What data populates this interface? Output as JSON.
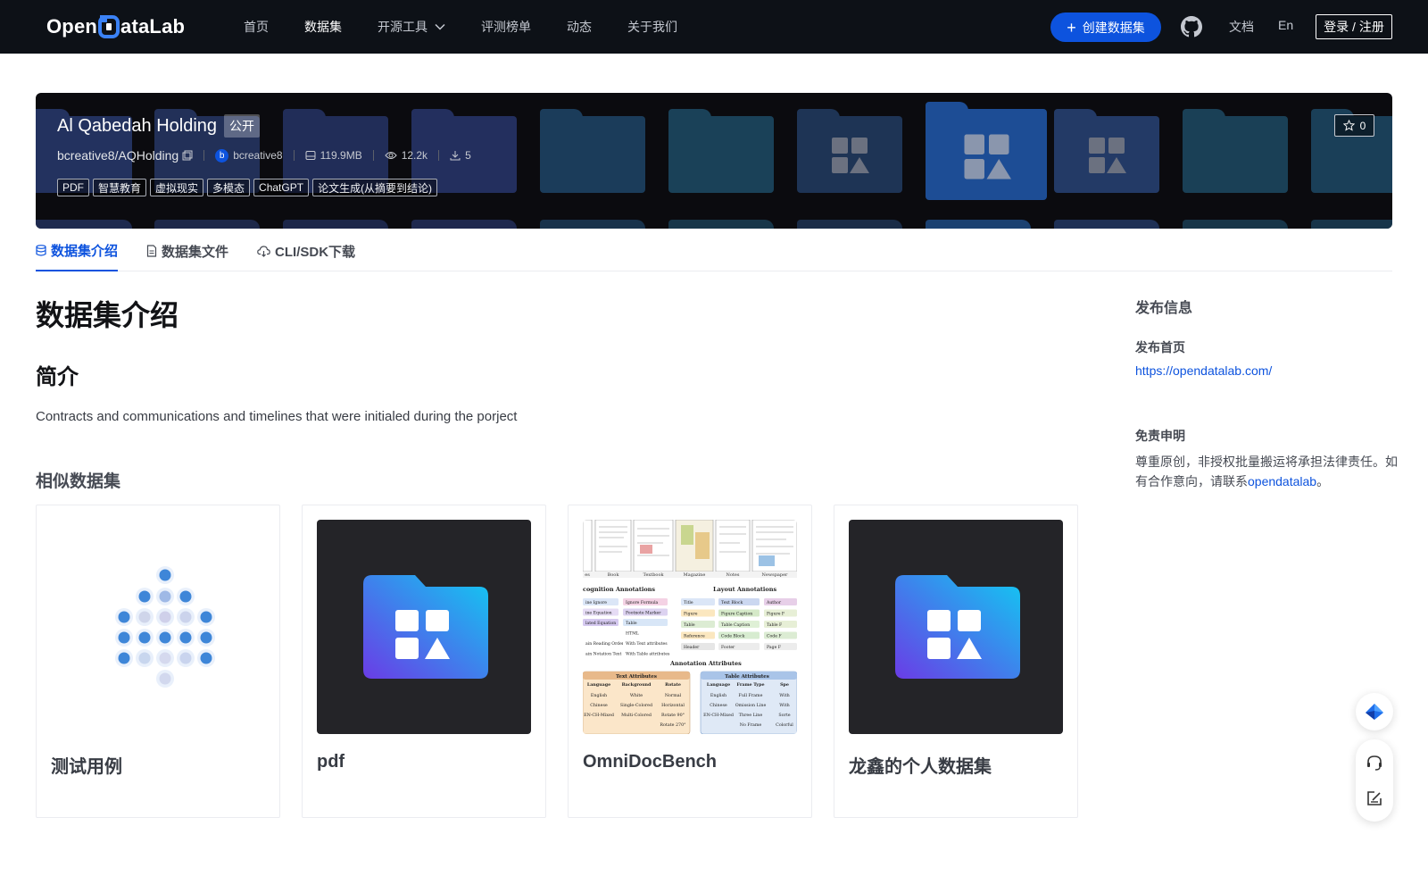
{
  "nav": {
    "logo": {
      "left": "Open",
      "right": "ataLab"
    },
    "menu": [
      {
        "label": "首页",
        "active": false
      },
      {
        "label": "数据集",
        "active": true
      },
      {
        "label": "开源工具",
        "active": false,
        "dropdown": true
      },
      {
        "label": "评测榜单",
        "active": false
      },
      {
        "label": "动态",
        "active": false
      },
      {
        "label": "关于我们",
        "active": false
      }
    ],
    "create_label": "创建数据集",
    "github_icon": "github-icon",
    "docs_label": "文档",
    "lang_label": "En",
    "login_label": "登录 / 注册"
  },
  "banner": {
    "title": "Al Qabedah Holding",
    "visibility": "公开",
    "repo": "bcreative8/AQHolding",
    "author_initial": "b",
    "author": "bcreative8",
    "size": "119.9MB",
    "views": "12.2k",
    "downloads": "5",
    "tags": [
      "PDF",
      "智慧教育",
      "虚拟现实",
      "多模态",
      "ChatGPT",
      "论文生成(从摘要到结论)"
    ],
    "stars": "0"
  },
  "tabs": [
    {
      "label": "数据集介绍",
      "icon": "database-icon",
      "active": true
    },
    {
      "label": "数据集文件",
      "icon": "file-icon",
      "active": false
    },
    {
      "label": "CLI/SDK下载",
      "icon": "cloud-download-icon",
      "active": false
    }
  ],
  "main": {
    "title": "数据集介绍",
    "intro_heading": "简介",
    "description": "Contracts and communications and timelines that were initialed during the porject",
    "similar_heading": "相似数据集",
    "similar": [
      {
        "name": "测试用例",
        "thumb": "dots"
      },
      {
        "name": "pdf",
        "thumb": "folder"
      },
      {
        "name": "OmniDocBench",
        "thumb": "document-collage"
      },
      {
        "name": "龙鑫的个人数据集",
        "thumb": "folder"
      }
    ],
    "omni_thumb": {
      "top_labels": [
        "es",
        "Book",
        "Textbook",
        "Magazine",
        "Notes",
        "Newspaper"
      ],
      "recog_heading": "cognition Annotations",
      "layout_heading": "Layout Annotations",
      "attr_heading": "Annotation Attributes",
      "text_attr_heading": "Text Attributes",
      "table_attr_heading": "Table Attributes",
      "recog_col1": [
        "ine Ignore",
        "ine Equation",
        "lated Equation",
        "",
        "ain Reading Order",
        "ain Notation Text"
      ],
      "recog_col2": [
        "Ignore Formula",
        "Footnote Marker",
        "Table",
        "HTML",
        "With Text attributes",
        "With Table attributes"
      ],
      "layout_col1": [
        "Title",
        "Figure",
        "Table",
        "Reference",
        "Header"
      ],
      "layout_col2": [
        "Text Block",
        "Figure Caption",
        "Table Caption",
        "Code Block",
        "Footer"
      ],
      "layout_col3": [
        "Author",
        "Figure F",
        "Table F",
        "Code F",
        "Page F"
      ],
      "text_attr_cols": [
        "Language",
        "Background",
        "Rotate"
      ],
      "text_attr_rows": [
        [
          "English",
          "White",
          "Normal"
        ],
        [
          "Chinese",
          "Single-Colored",
          "Horizontal"
        ],
        [
          "EN-CH-Mixed",
          "Multi-Colored",
          "Rotate 90°"
        ],
        [
          "",
          "",
          "Rotate 270°"
        ]
      ],
      "table_attr_cols": [
        "Language",
        "Frame Type",
        "Spe"
      ],
      "table_attr_rows": [
        [
          "English",
          "Full Frame",
          "With"
        ],
        [
          "Chinese",
          "Omission Line",
          "With"
        ],
        [
          "EN-CH-Mixed",
          "Three Line",
          "Sorte"
        ],
        [
          "",
          "No Frame",
          "Colorful"
        ]
      ]
    }
  },
  "sidebar": {
    "title": "发布信息",
    "homepage_label": "发布首页",
    "homepage_url": "https://opendatalab.com/",
    "disclaimer_label": "免责申明",
    "disclaimer_text": "尊重原创，非授权批量搬运将承担法律责任。如有合作意向，请联系",
    "disclaimer_link": "opendatalab",
    "disclaimer_end": "。"
  },
  "floating": [
    "lark-icon",
    "headset-icon",
    "feedback-icon"
  ],
  "colors": {
    "nav_bg": "#0d1117",
    "brand": "#0d53de",
    "banner_bg": "#0b0b0f"
  }
}
